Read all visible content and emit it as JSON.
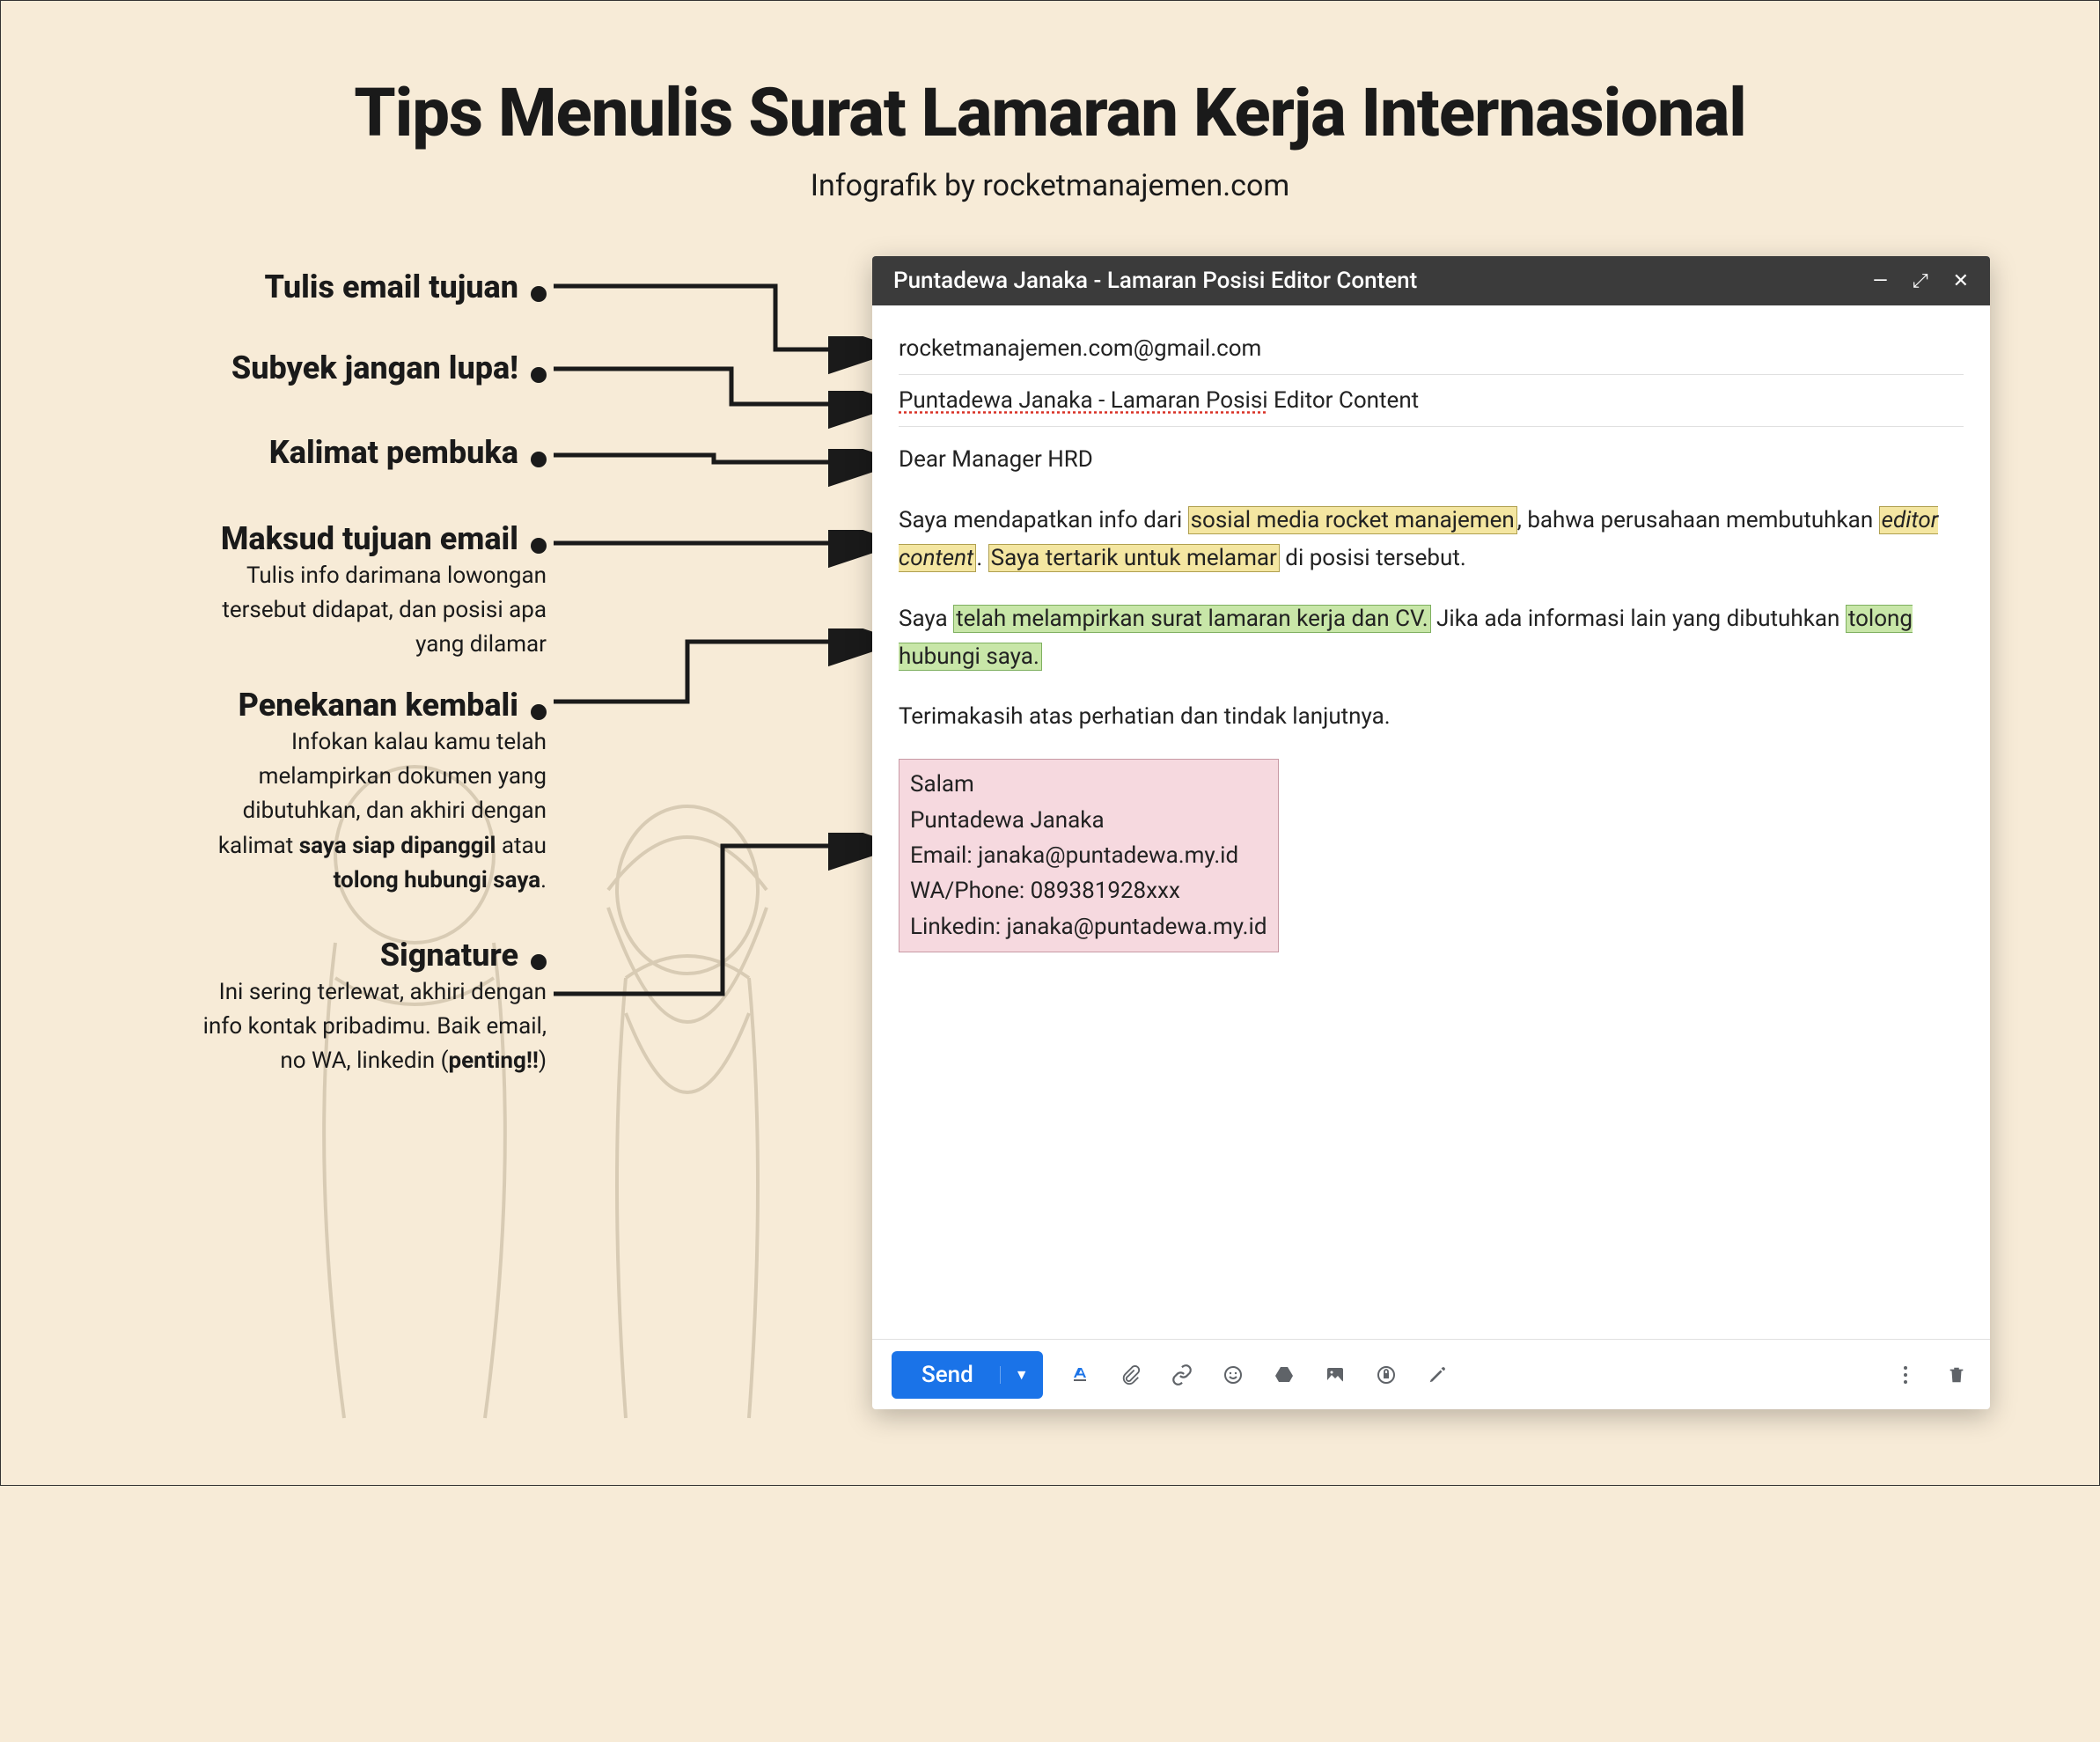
{
  "title": "Tips Menulis Surat Lamaran Kerja Internasional",
  "subtitle": "Infografik by rocketmanajemen.com",
  "tips": {
    "t1": {
      "title": "Tulis email tujuan"
    },
    "t2": {
      "title": "Subyek jangan lupa!"
    },
    "t3": {
      "title": "Kalimat pembuka"
    },
    "t4": {
      "title": "Maksud tujuan email",
      "sub_a": "Tulis info darimana lowongan",
      "sub_b": "tersebut didapat, dan posisi apa",
      "sub_c": "yang dilamar"
    },
    "t5": {
      "title": "Penekanan kembali",
      "sub_a": "Infokan kalau kamu telah",
      "sub_b": "melampirkan dokumen yang",
      "sub_c": "dibutuhkan, dan akhiri dengan",
      "sub_d_pre": "kalimat ",
      "sub_d_b1": "saya siap dipanggil",
      "sub_d_mid": " atau",
      "sub_e_b": "tolong hubungi saya",
      "sub_e_post": "."
    },
    "t6": {
      "title": "Signature",
      "sub_a": "Ini sering terlewat, akhiri dengan",
      "sub_b": "info kontak pribadimu. Baik email,",
      "sub_c_pre": "no WA, linkedin (",
      "sub_c_b": "penting!!",
      "sub_c_post": ")"
    }
  },
  "email": {
    "window_title": "Puntadewa Janaka - Lamaran Posisi Editor Content",
    "to": "rocketmanajemen.com@gmail.com",
    "subject_spell": "Puntadewa Janaka - Lamaran Posisi",
    "subject_tail": " Editor Content",
    "greeting": "Dear Manager HRD",
    "p1_a": "Saya mendapatkan info dari ",
    "p1_hl1": "sosial media rocket manajemen",
    "p1_b": ", bahwa perusahaan membutuhkan ",
    "p1_hl2": "editor content",
    "p1_c": ". ",
    "p1_hl3": "Saya tertarik untuk melamar",
    "p1_d": " di posisi tersebut.",
    "p2_a": "Saya ",
    "p2_hl1": "telah melampirkan surat lamaran kerja dan CV.",
    "p2_b": " Jika ada informasi lain yang dibutuhkan ",
    "p2_hl2": "tolong hubungi saya.",
    "p3": "Terimakasih atas perhatian dan tindak lanjutnya.",
    "sig_salam": "Salam",
    "sig_name": "Puntadewa Janaka",
    "sig_email": "Email: janaka@puntadewa.my.id",
    "sig_phone": "WA/Phone: 089381928xxx",
    "sig_linkedin": "Linkedin: janaka@puntadewa.my.id",
    "send": "Send"
  }
}
